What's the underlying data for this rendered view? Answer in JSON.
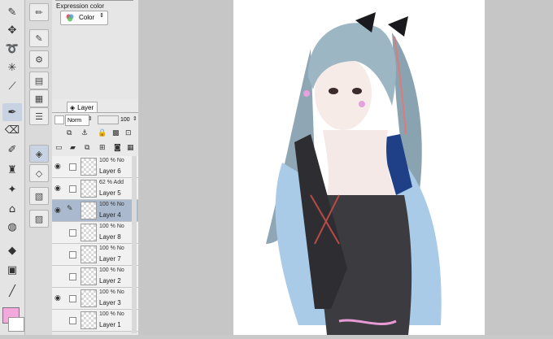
{
  "tools": [
    {
      "icon": "brush-icon",
      "glyph": "✎"
    },
    {
      "icon": "move-icon",
      "glyph": "✥"
    },
    {
      "icon": "lasso-icon",
      "glyph": "➰"
    },
    {
      "icon": "magic-wand-icon",
      "glyph": "✳"
    },
    {
      "icon": "eyedropper-icon",
      "glyph": "⟋"
    },
    {
      "icon": "pen-icon",
      "glyph": "✒"
    },
    {
      "icon": "eraser-icon",
      "glyph": "⌫"
    },
    {
      "icon": "fountain-pen-icon",
      "glyph": "✐"
    },
    {
      "icon": "stamp-icon",
      "glyph": "♜"
    },
    {
      "icon": "sparkle-icon",
      "glyph": "✦"
    },
    {
      "icon": "smudge-icon",
      "glyph": "⌂"
    },
    {
      "icon": "blend-icon",
      "glyph": "◍"
    },
    {
      "icon": "fill-icon",
      "glyph": "◆"
    },
    {
      "icon": "gradient-icon",
      "glyph": "▣"
    },
    {
      "icon": "line-icon",
      "glyph": "╱"
    }
  ],
  "main_color": "#f4a9dc",
  "sub_color": "#ffffff",
  "properties": {
    "label": "Expression color",
    "select_value": "Color"
  },
  "layer_panel": {
    "tab_label": "Layer",
    "blend_mode": "Norm",
    "opacity": "100"
  },
  "layers": [
    {
      "percent": "100 %",
      "mode": "No",
      "name": "Layer 6",
      "selected": false,
      "visible": true
    },
    {
      "percent": "62 %",
      "mode": "Add",
      "name": "Layer 5",
      "selected": false,
      "visible": true
    },
    {
      "percent": "100 %",
      "mode": "No",
      "name": "Layer 4",
      "selected": true,
      "visible": true
    },
    {
      "percent": "100 %",
      "mode": "No",
      "name": "Layer 8",
      "selected": false,
      "visible": false
    },
    {
      "percent": "100 %",
      "mode": "No",
      "name": "Layer 7",
      "selected": false,
      "visible": false
    },
    {
      "percent": "100 %",
      "mode": "No",
      "name": "Layer 2",
      "selected": false,
      "visible": false
    },
    {
      "percent": "100 %",
      "mode": "No",
      "name": "Layer 3",
      "selected": false,
      "visible": true
    },
    {
      "percent": "100 %",
      "mode": "No",
      "name": "Layer 1",
      "selected": false,
      "visible": false
    }
  ]
}
